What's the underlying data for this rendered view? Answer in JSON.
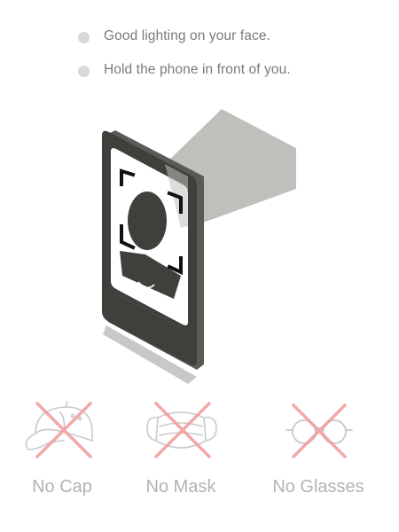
{
  "tips": [
    {
      "text": "Good lighting on your face."
    },
    {
      "text": "Hold the phone in front of you."
    }
  ],
  "prohibitions": [
    {
      "label": "No Cap",
      "icon": "cap-icon"
    },
    {
      "label": "No Mask",
      "icon": "mask-icon"
    },
    {
      "label": "No Glasses",
      "icon": "glasses-icon"
    }
  ],
  "colors": {
    "phone": "#3f403c",
    "screen": "#ffffff",
    "light_beam": "#bfbfbb",
    "shadow": "#c8c8c8",
    "cross": "#f29a9a",
    "icon_outline": "#c9c9c9",
    "label_text": "#b3b3b3",
    "tip_text": "#7a7a7a",
    "bullet": "#d8d8d8"
  }
}
